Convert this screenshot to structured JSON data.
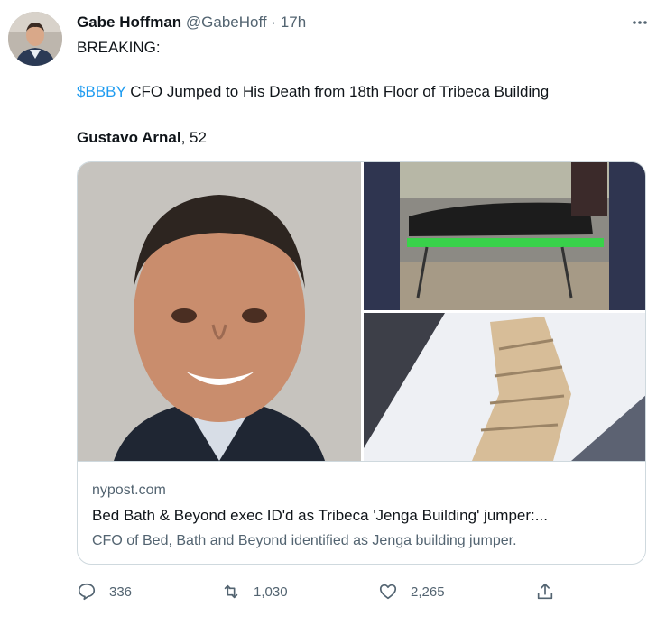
{
  "tweet": {
    "author_name": "Gabe Hoffman",
    "handle": "@GabeHoff",
    "separator": "·",
    "time": "17h",
    "line1": "BREAKING:",
    "cashtag": "$BBBY",
    "line2_rest": " CFO Jumped to His Death from 18th Floor of Tribeca Building",
    "person_name": "Gustavo Arnal",
    "person_age": ", 52"
  },
  "card": {
    "domain": "nypost.com",
    "title": "Bed Bath & Beyond exec ID'd as Tribeca 'Jenga Building' jumper:...",
    "description": "CFO of Bed, Bath and Beyond identified as Jenga building jumper."
  },
  "actions": {
    "replies": "336",
    "retweets": "1,030",
    "likes": "2,265"
  },
  "icons": {
    "more": "more-horizontal-icon",
    "reply": "reply-icon",
    "retweet": "retweet-icon",
    "like": "heart-icon",
    "share": "share-icon"
  },
  "colors": {
    "link": "#1d9bf0",
    "text": "#0f1419",
    "secondary": "#536471",
    "border": "#cfd9de"
  }
}
